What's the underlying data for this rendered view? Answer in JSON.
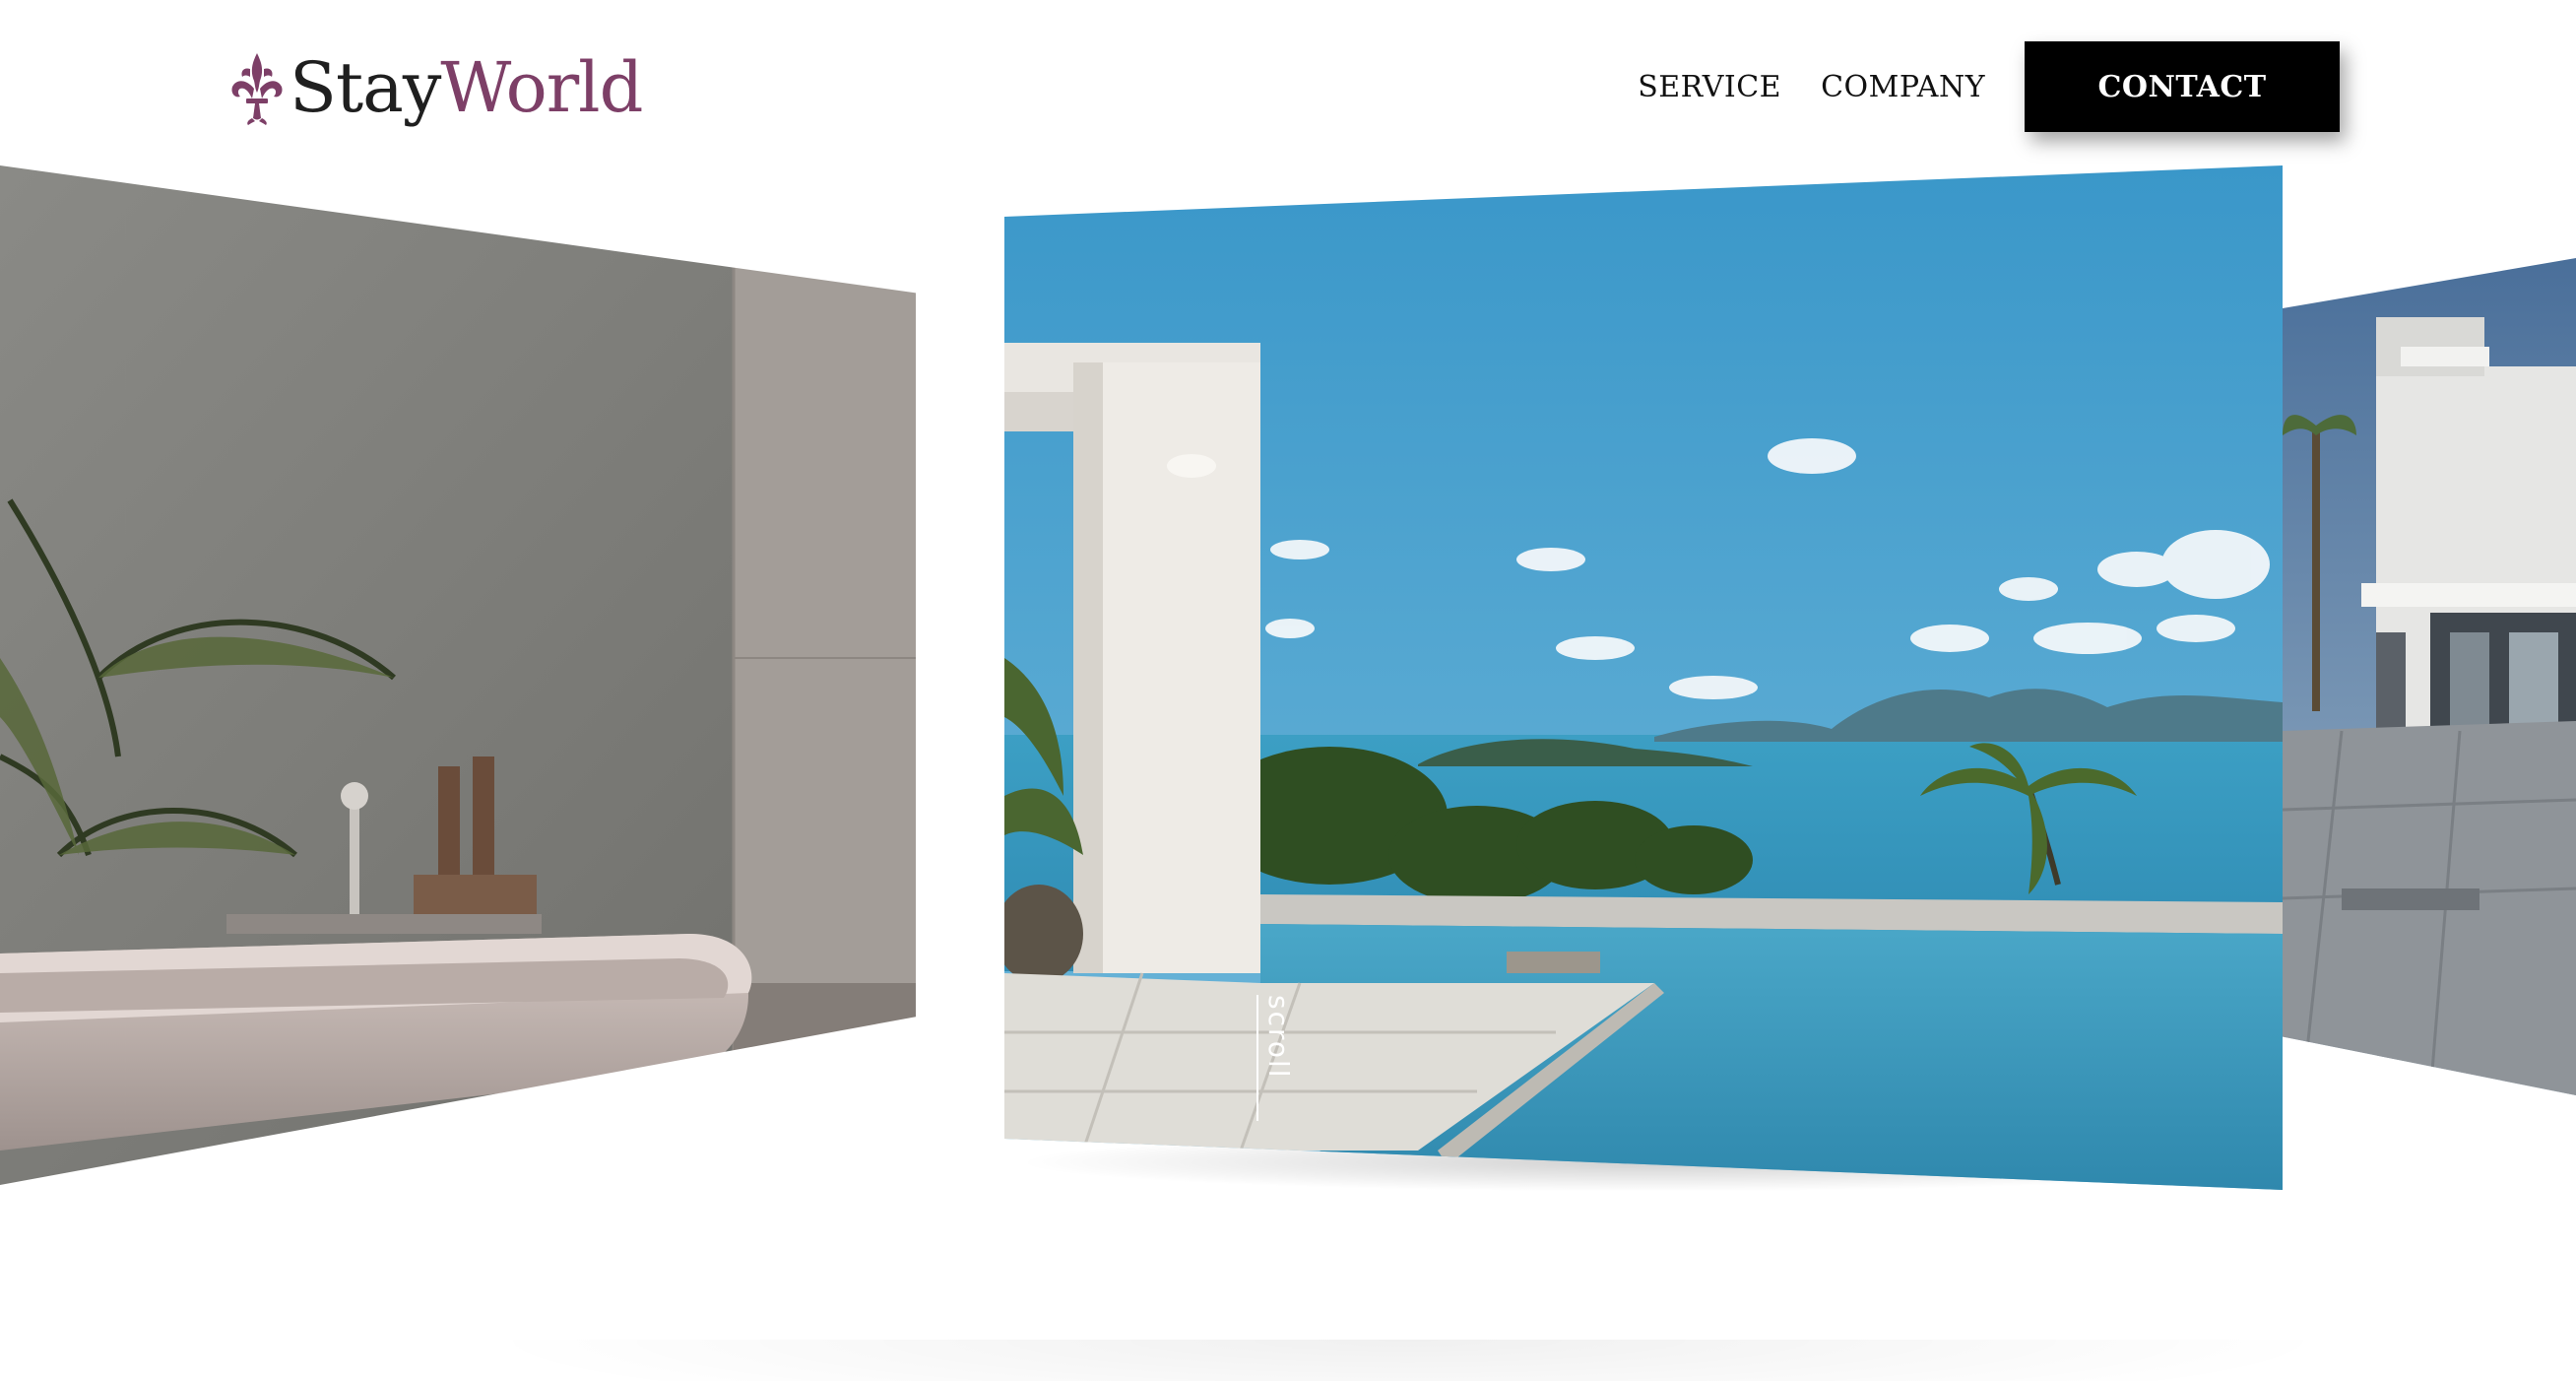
{
  "brand": {
    "part1": "Stay",
    "part2": "World",
    "color_dark": "#1f1f1f",
    "color_accent": "#7d3f67",
    "logo_icon": "fleur-de-lis-icon"
  },
  "nav": {
    "service": "SERVICE",
    "company": "COMPANY",
    "contact": "CONTACT"
  },
  "slider": {
    "scroll_label": "scroll",
    "slides": [
      {
        "name": "outdoor-bathtub-photo"
      },
      {
        "name": "infinity-pool-sea-view-photo"
      },
      {
        "name": "modern-villa-terrace-photo"
      }
    ]
  }
}
